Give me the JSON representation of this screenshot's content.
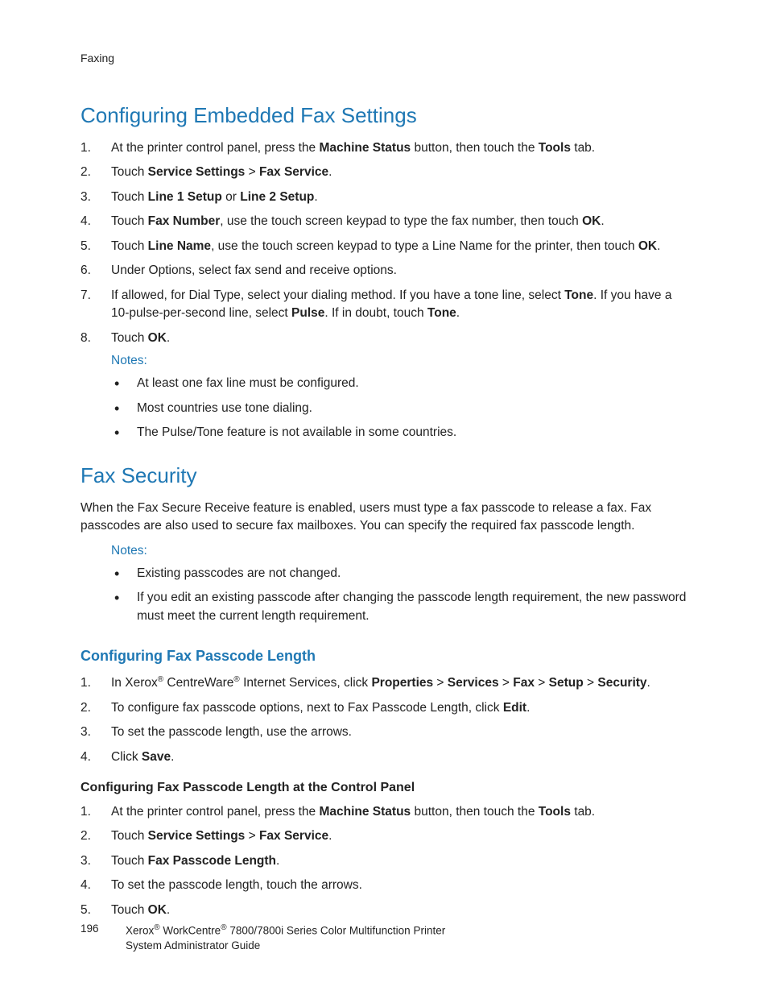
{
  "header": {
    "section_label": "Faxing"
  },
  "h1_configuring": "Configuring Embedded Fax Settings",
  "steps_configuring": {
    "s1a": "At the printer control panel, press the ",
    "s1b": "Machine Status",
    "s1c": " button, then touch the ",
    "s1d": "Tools",
    "s1e": " tab.",
    "s2a": "Touch ",
    "s2b": "Service Settings",
    "s2c": " > ",
    "s2d": "Fax Service",
    "s2e": ".",
    "s3a": "Touch ",
    "s3b": "Line 1 Setup",
    "s3c": " or ",
    "s3d": "Line 2 Setup",
    "s3e": ".",
    "s4a": "Touch ",
    "s4b": "Fax Number",
    "s4c": ", use the touch screen keypad to type the fax number, then touch ",
    "s4d": "OK",
    "s4e": ".",
    "s5a": "Touch ",
    "s5b": "Line Name",
    "s5c": ", use the touch screen keypad to type a Line Name for the printer, then touch ",
    "s5d": "OK",
    "s5e": ".",
    "s6": "Under Options, select fax send and receive options.",
    "s7a": "If allowed, for Dial Type, select your dialing method. If you have a tone line, select ",
    "s7b": "Tone",
    "s7c": ". If you have a 10-pulse-per-second line, select ",
    "s7d": "Pulse",
    "s7e": ". If in doubt, touch ",
    "s7f": "Tone",
    "s7g": ".",
    "s8a": "Touch ",
    "s8b": "OK",
    "s8c": "."
  },
  "notes1_label": "Notes:",
  "notes1": {
    "n1": "At least one fax line must be configured.",
    "n2": "Most countries use tone dialing.",
    "n3": "The Pulse/Tone feature is not available in some countries."
  },
  "h1_security": "Fax Security",
  "security_intro": "When the Fax Secure Receive feature is enabled, users must type a fax passcode to release a fax. Fax passcodes are also used to secure fax mailboxes. You can specify the required fax passcode length.",
  "notes2_label": "Notes:",
  "notes2": {
    "n1": "Existing passcodes are not changed.",
    "n2": "If you edit an existing passcode after changing the passcode length requirement, the new password must meet the current length requirement."
  },
  "h2_passcode": "Configuring Fax Passcode Length",
  "steps_passcode": {
    "s1a": "In Xerox",
    "s1b": " CentreWare",
    "s1c": " Internet Services, click ",
    "s1d": "Properties",
    "s1e": " > ",
    "s1f": "Services",
    "s1g": " > ",
    "s1h": "Fax",
    "s1i": " > ",
    "s1j": "Setup",
    "s1k": " > ",
    "s1l": "Security",
    "s1m": ".",
    "s2a": "To configure fax passcode options, next to Fax Passcode Length, click ",
    "s2b": "Edit",
    "s2c": ".",
    "s3": "To set the passcode length, use the arrows.",
    "s4a": "Click ",
    "s4b": "Save",
    "s4c": "."
  },
  "h3_control_panel": "Configuring Fax Passcode Length at the Control Panel",
  "steps_control_panel": {
    "s1a": "At the printer control panel, press the ",
    "s1b": "Machine Status",
    "s1c": " button, then touch the ",
    "s1d": "Tools",
    "s1e": " tab.",
    "s2a": "Touch ",
    "s2b": "Service Settings",
    "s2c": " > ",
    "s2d": "Fax Service",
    "s2e": ".",
    "s3a": "Touch ",
    "s3b": "Fax Passcode Length",
    "s3c": ".",
    "s4": "To set the passcode length, touch the arrows.",
    "s5a": "Touch ",
    "s5b": "OK",
    "s5c": "."
  },
  "footer": {
    "page": "196",
    "line1a": "Xerox",
    "line1b": " WorkCentre",
    "line1c": " 7800/7800i Series Color Multifunction Printer",
    "line2": "System Administrator Guide",
    "reg": "®"
  }
}
